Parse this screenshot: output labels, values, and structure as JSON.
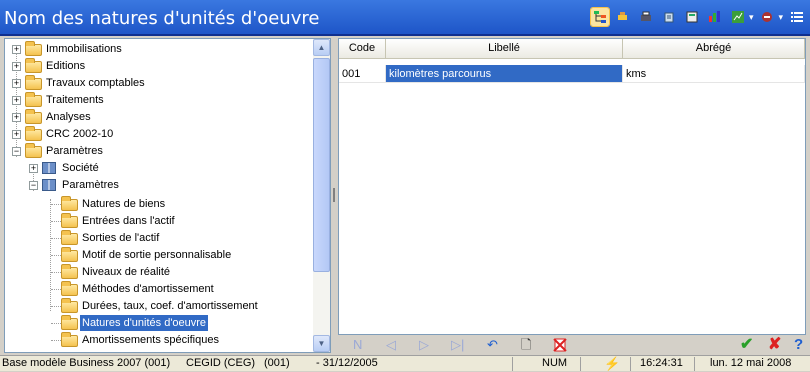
{
  "window": {
    "title": "Nom des natures d'unités d'oeuvre"
  },
  "toolbar": {
    "icons": [
      "tree-structure-icon",
      "pin-icon",
      "printer-icon",
      "export-icon",
      "calculator-icon",
      "columns-icon",
      "chart-icon",
      "tools-icon",
      "list-icon"
    ]
  },
  "tree": {
    "items": [
      {
        "label": "Immobilisations",
        "level": 0,
        "expanded": false,
        "icon": "folder-icon"
      },
      {
        "label": "Editions",
        "level": 0,
        "expanded": false,
        "icon": "folder-icon"
      },
      {
        "label": "Travaux comptables",
        "level": 0,
        "expanded": false,
        "icon": "folder-icon"
      },
      {
        "label": "Traitements",
        "level": 0,
        "expanded": false,
        "icon": "folder-icon"
      },
      {
        "label": "Analyses",
        "level": 0,
        "expanded": false,
        "icon": "folder-icon"
      },
      {
        "label": "CRC 2002-10",
        "level": 0,
        "expanded": false,
        "icon": "folder-icon"
      },
      {
        "label": "Paramètres",
        "level": 0,
        "expanded": true,
        "icon": "folder-icon"
      },
      {
        "label": "Société",
        "level": 1,
        "expanded": false,
        "icon": "book-icon"
      },
      {
        "label": "Paramètres",
        "level": 1,
        "expanded": true,
        "icon": "book-icon"
      },
      {
        "label": "Natures de biens",
        "level": 2,
        "icon": "folder-icon"
      },
      {
        "label": "Entrées dans l'actif",
        "level": 2,
        "icon": "folder-icon"
      },
      {
        "label": "Sorties de l'actif",
        "level": 2,
        "icon": "folder-icon"
      },
      {
        "label": "Motif de sortie personnalisable",
        "level": 2,
        "icon": "folder-icon"
      },
      {
        "label": "Niveaux de réalité",
        "level": 2,
        "icon": "folder-icon"
      },
      {
        "label": "Méthodes d'amortissement",
        "level": 2,
        "icon": "folder-icon"
      },
      {
        "label": "Durées, taux, coef. d'amortissement",
        "level": 2,
        "icon": "folder-icon"
      },
      {
        "label": "Natures d'unités d'oeuvre",
        "level": 2,
        "icon": "folder-icon",
        "selected": true
      },
      {
        "label": "Amortissements spécifiques",
        "level": 2,
        "icon": "folder-icon"
      }
    ]
  },
  "grid": {
    "columns": [
      "Code",
      "Libellé",
      "Abrégé"
    ],
    "rows": [
      {
        "code": "001",
        "libelle": "kilomètres parcourus",
        "abrege": "kms"
      }
    ]
  },
  "navbar": {
    "icons": [
      "first-record-icon",
      "previous-record-icon",
      "next-record-icon",
      "last-record-icon",
      "undo-icon",
      "new-record-icon",
      "delete-record-icon",
      "validate-icon",
      "cancel-icon",
      "help-icon"
    ],
    "help_glyph": "?"
  },
  "status": {
    "database": "Base modèle Business 2007 (001)",
    "company": "CEGID (CEG)",
    "code": "(001)",
    "date_end": "- 31/12/2005",
    "numlock": "NUM",
    "time": "16:24:31",
    "date": "lun. 12 mai 2008"
  },
  "colors": {
    "title_bar": "#2a66d8",
    "selection": "#316ac5",
    "validate": "#2aa02a",
    "cancel": "#d22222"
  }
}
